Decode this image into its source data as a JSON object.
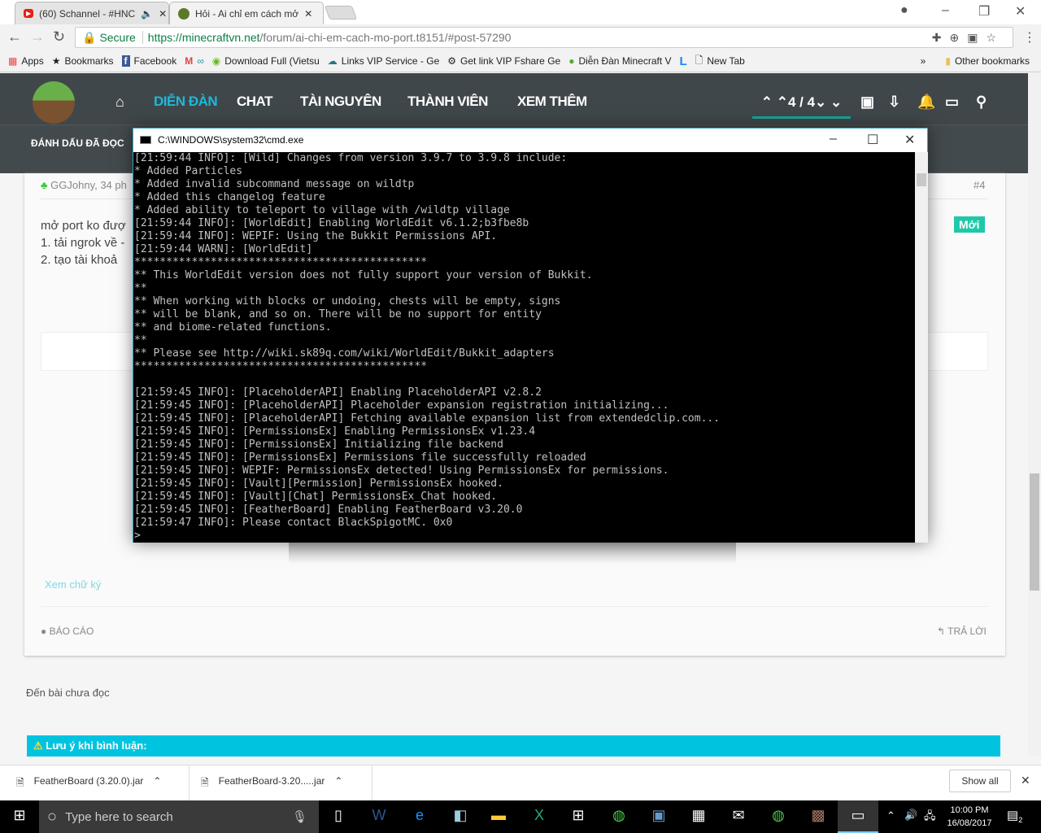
{
  "browser": {
    "tabs": [
      {
        "label": "(60) Schannel - #HNC"
      },
      {
        "label": "Hỏi - Ai chỉ em cách mở"
      }
    ],
    "secure_label": "Secure",
    "url_host": "https://minecraftvn.net",
    "url_path": "/forum/ai-chi-em-cach-mo-port.t8151/#post-57290",
    "bookmarks": [
      "Apps",
      "Bookmarks",
      "Facebook",
      "Download Full (Vietsu",
      "Links VIP Service - Ge",
      "Get link VIP Fshare Ge",
      "Diễn Đàn Minecraft V",
      "New Tab"
    ],
    "other_bookmarks": "Other bookmarks"
  },
  "forum": {
    "nav": [
      "DIỄN ĐÀN",
      "CHAT",
      "TÀI NGUYÊN",
      "THÀNH VIÊN",
      "XEM THÊM"
    ],
    "page_indicator": "4 / 4",
    "mark_read": "ĐÁNH DẤU ĐÃ ĐỌC",
    "post": {
      "author_meta": "GGJohny, 34 ph",
      "number": "#4",
      "badge": "Mới",
      "lines": [
        "mở port ko đượ",
        "1. tải ngrok về -",
        "2. tạo tài khoả"
      ],
      "signature_link": "Xem chữ ký",
      "report": "BÁO CÁO",
      "reply": "TRẢ LỜI"
    },
    "unread_link": "Đến bài chưa đọc",
    "notice": "Lưu ý khi bình luận:",
    "accent": "#1fb8d8"
  },
  "cmd": {
    "title": "C:\\WINDOWS\\system32\\cmd.exe",
    "lines": [
      "[21:59:44 INFO]: [Wild] Changes from version 3.9.7 to 3.9.8 include:",
      "* Added Particles",
      "* Added invalid subcommand message on wildtp",
      "* Added this changelog feature",
      "* Added ability to teleport to village with /wildtp village",
      "[21:59:44 INFO]: [WorldEdit] Enabling WorldEdit v6.1.2;b3fbe8b",
      "[21:59:44 INFO]: WEPIF: Using the Bukkit Permissions API.",
      "[21:59:44 WARN]: [WorldEdit]",
      "**********************************************",
      "** This WorldEdit version does not fully support your version of Bukkit.",
      "**",
      "** When working with blocks or undoing, chests will be empty, signs",
      "** will be blank, and so on. There will be no support for entity",
      "** and biome-related functions.",
      "**",
      "** Please see http://wiki.sk89q.com/wiki/WorldEdit/Bukkit_adapters",
      "**********************************************",
      "",
      "[21:59:45 INFO]: [PlaceholderAPI] Enabling PlaceholderAPI v2.8.2",
      "[21:59:45 INFO]: [PlaceholderAPI] Placeholder expansion registration initializing...",
      "[21:59:45 INFO]: [PlaceholderAPI] Fetching available expansion list from extendedclip.com...",
      "[21:59:45 INFO]: [PermissionsEx] Enabling PermissionsEx v1.23.4",
      "[21:59:45 INFO]: [PermissionsEx] Initializing file backend",
      "[21:59:45 INFO]: [PermissionsEx] Permissions file successfully reloaded",
      "[21:59:45 INFO]: WEPIF: PermissionsEx detected! Using PermissionsEx for permissions.",
      "[21:59:45 INFO]: [Vault][Permission] PermissionsEx hooked.",
      "[21:59:45 INFO]: [Vault][Chat] PermissionsEx_Chat hooked.",
      "[21:59:45 INFO]: [FeatherBoard] Enabling FeatherBoard v3.20.0",
      "[21:59:47 INFO]: Please contact BlackSpigotMC. 0x0",
      ">"
    ]
  },
  "downloads": {
    "items": [
      "FeatherBoard (3.20.0).jar",
      "FeatherBoard-3.20.....jar"
    ],
    "show_all": "Show all"
  },
  "taskbar": {
    "search_placeholder": "Type here to search",
    "time": "10:00 PM",
    "date": "16/08/2017",
    "notification_count": "2"
  }
}
